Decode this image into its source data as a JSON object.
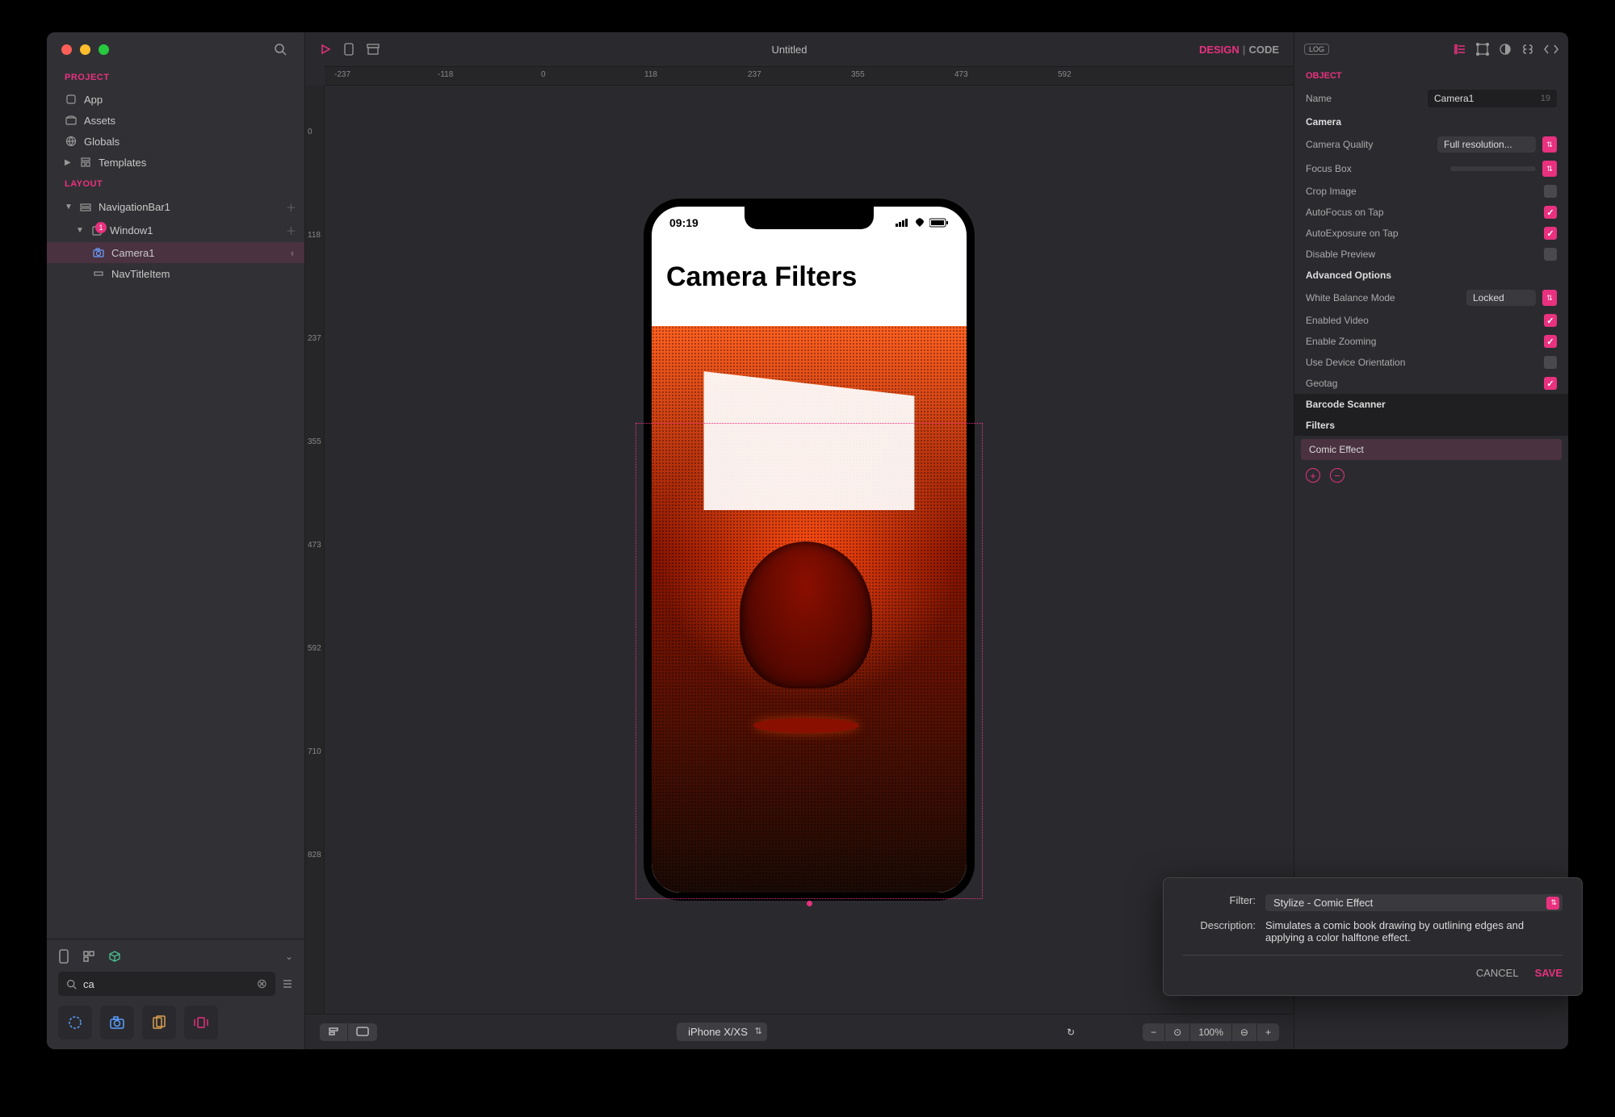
{
  "documentTitle": "Untitled",
  "modes": {
    "design": "DESIGN",
    "code": "CODE"
  },
  "logBadge": "LOG",
  "sidebar": {
    "projectHeading": "PROJECT",
    "items": {
      "app": "App",
      "assets": "Assets",
      "globals": "Globals",
      "templates": "Templates"
    },
    "layoutHeading": "LAYOUT",
    "nav1": "NavigationBar1",
    "window1": "Window1",
    "camera1": "Camera1",
    "navTitle": "NavTitleItem",
    "searchText": "ca"
  },
  "rulerH": [
    "-237",
    "-118",
    "0",
    "118",
    "237",
    "355",
    "473",
    "592"
  ],
  "rulerV": [
    "0",
    "118",
    "237",
    "355",
    "473",
    "592",
    "710",
    "828"
  ],
  "device": {
    "time": "09:19",
    "appTitle": "Camera Filters"
  },
  "bottombar": {
    "deviceModel": "iPhone X/XS",
    "zoom": "100%"
  },
  "inspector": {
    "objectHeading": "OBJECT",
    "nameLabel": "Name",
    "nameValue": "Camera1",
    "nameCount": "19",
    "cameraSection": "Camera",
    "labels": {
      "quality": "Camera Quality",
      "focusBox": "Focus Box",
      "cropImage": "Crop Image",
      "autoFocus": "AutoFocus on Tap",
      "autoExposure": "AutoExposure on Tap",
      "disablePreview": "Disable Preview"
    },
    "qualityValue": "Full resolution...",
    "advancedSection": "Advanced Options",
    "advLabels": {
      "whiteBalance": "White Balance Mode",
      "enabledVideo": "Enabled Video",
      "enableZoom": "Enable Zooming",
      "deviceOrientation": "Use Device Orientation",
      "geotag": "Geotag"
    },
    "whiteBalanceValue": "Locked",
    "barcodeSection": "Barcode Scanner",
    "filtersSection": "Filters",
    "filterItem": "Comic Effect"
  },
  "popover": {
    "filterLabel": "Filter:",
    "filterValue": "Stylize - Comic Effect",
    "descLabel": "Description:",
    "descValue": "Simulates a comic book drawing by outlining edges and applying a color halftone effect.",
    "cancel": "CANCEL",
    "save": "SAVE"
  }
}
